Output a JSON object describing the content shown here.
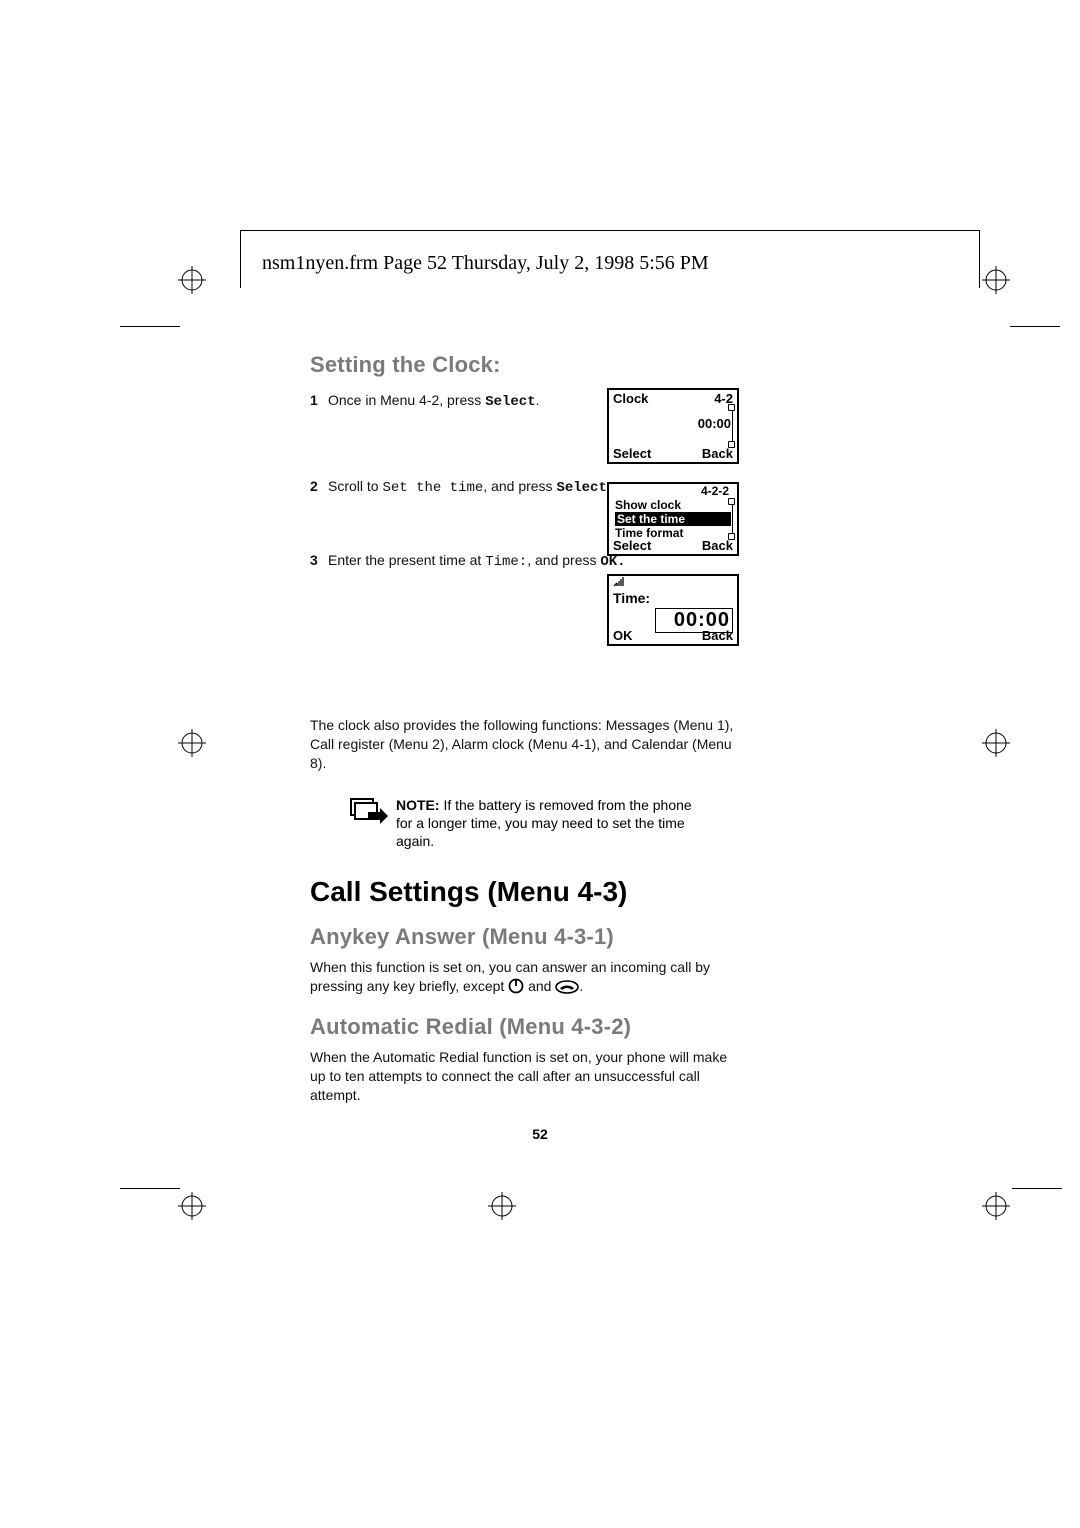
{
  "header": {
    "line": "nsm1nyen.frm  Page 52  Thursday, July 2, 1998  5:56 PM"
  },
  "section": {
    "setting_clock_title": "Setting the Clock:",
    "steps": {
      "s1_num": "1",
      "s1_prefix": "Once in Menu 4-2, press ",
      "s1_cmd": "Select",
      "s1_suffix": ".",
      "s2_num": "2",
      "s2_prefix": "Scroll to ",
      "s2_mono": "Set the time",
      "s2_mid": ", and press ",
      "s2_cmd": "Select.",
      "s3_num": "3",
      "s3_prefix": "Enter the present time at  ",
      "s3_mono": "Time:",
      "s3_mid": ", and press ",
      "s3_cmd": "OK."
    },
    "functions_para": "The clock also provides the following functions: Messages (Menu 1), Call register (Menu 2), Alarm clock (Menu 4-1), and Calendar (Menu 8).",
    "note_label": "NOTE: ",
    "note_body": "If the battery is removed from the phone for a longer time, you may need to set the time again."
  },
  "screens": {
    "ps1": {
      "menu": "4-2",
      "title": "Clock",
      "time": "00:00",
      "left": "Select",
      "right": "Back"
    },
    "ps2": {
      "menu": "4-2-2",
      "items": [
        "Show clock",
        "Set the time",
        "Time format"
      ],
      "sel_index": 1,
      "left": "Select",
      "right": "Back"
    },
    "ps3": {
      "title": "Time:",
      "value": "00:00",
      "left": "OK",
      "right": "Back"
    }
  },
  "call_settings": {
    "title": "Call Settings (Menu 4-3)",
    "anykey_title": "Anykey Answer (Menu 4-3-1)",
    "anykey_para_a": "When this function is set on, you can answer an incoming call by pressing any key briefly, except ",
    "anykey_para_mid": " and ",
    "anykey_para_end": ".",
    "auto_title": "Automatic Redial (Menu 4-3-2)",
    "auto_para": "When the Automatic Redial function is set on, your phone will make up to ten attempts to connect the call after an unsuccessful call attempt."
  },
  "page_number": "52"
}
